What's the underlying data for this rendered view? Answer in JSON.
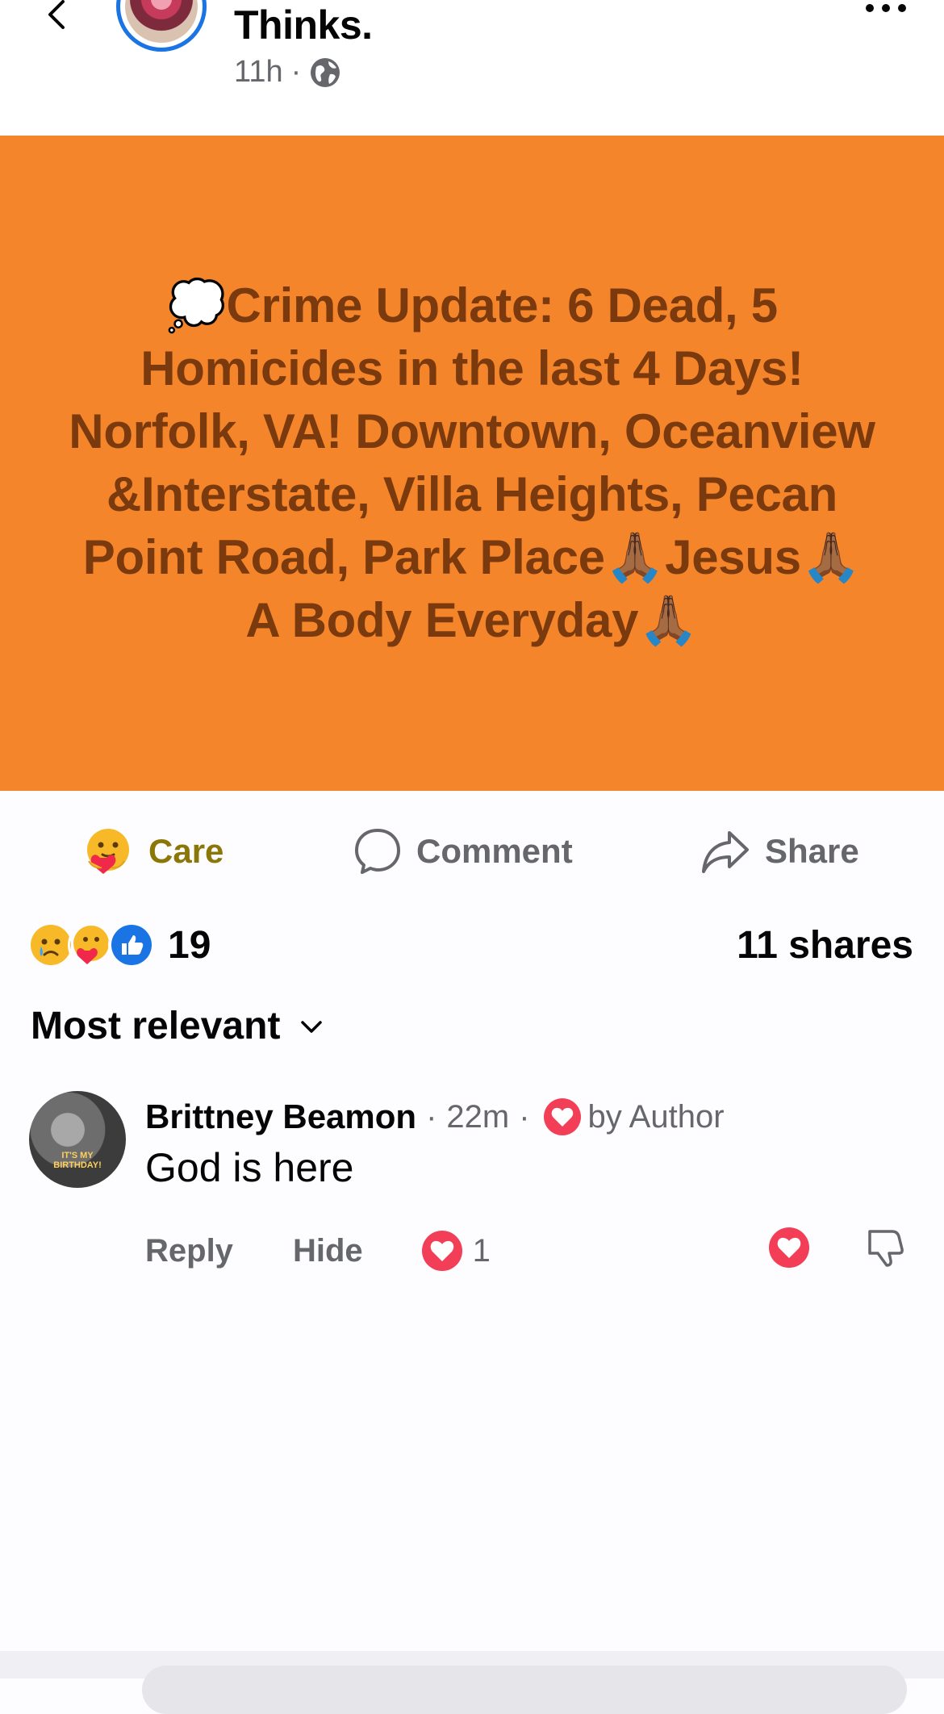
{
  "header": {
    "page_name": "Thinks.",
    "time": "11h",
    "separator": "·",
    "audience_icon": "globe-icon",
    "back_icon": "chevron-left-icon",
    "more_icon": "ellipsis-icon"
  },
  "post": {
    "background_color": "#f5852a",
    "text_color": "#7a3a0e",
    "text": "💭Crime Update: 6 Dead, 5 Homicides in the last 4 Days! Norfolk, VA! Downtown, Oceanview &Interstate, Villa Heights, Pecan Point Road, Park Place🙏🏾Jesus🙏🏾 A Body Everyday🙏🏾"
  },
  "actions": {
    "care_label": "Care",
    "comment_label": "Comment",
    "share_label": "Share",
    "care_color": "#8b7707"
  },
  "reactions": {
    "types": [
      "sad",
      "care",
      "like"
    ],
    "count": "19",
    "shares": "11 shares"
  },
  "sort": {
    "label": "Most relevant"
  },
  "comments": [
    {
      "author": "Brittney Beamon",
      "time": "22m",
      "badge": "by Author",
      "text": "God is here",
      "avatar_text": "IT'S MY BIRTHDAY!",
      "reply_label": "Reply",
      "hide_label": "Hide",
      "reaction_count": "1"
    }
  ]
}
